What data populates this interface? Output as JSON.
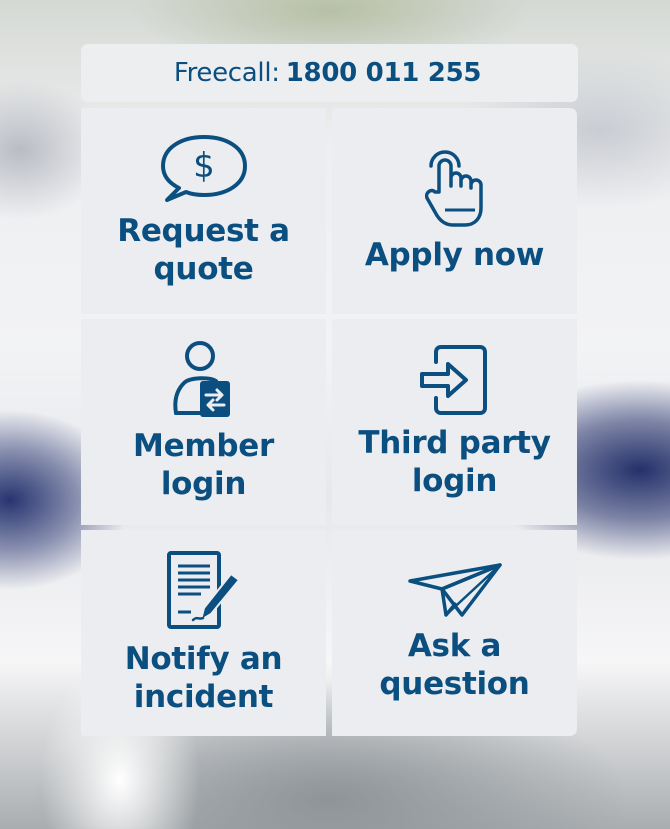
{
  "freecall": {
    "label": "Freecall:",
    "number": "1800 011 255"
  },
  "tiles": [
    {
      "icon": "speech-bubble-dollar-icon",
      "line1": "Request a",
      "line2": "quote"
    },
    {
      "icon": "tap-finger-icon",
      "line1": "Apply now",
      "line2": ""
    },
    {
      "icon": "member-login-icon",
      "line1": "Member",
      "line2": "login"
    },
    {
      "icon": "login-arrow-icon",
      "line1": "Third party",
      "line2": "login"
    },
    {
      "icon": "document-pen-icon",
      "line1": "Notify an",
      "line2": "incident"
    },
    {
      "icon": "paper-plane-icon",
      "line1": "Ask a",
      "line2": "question"
    }
  ],
  "colors": {
    "text_primary": "#0b4f80",
    "tile_background": "#ecedf0"
  }
}
